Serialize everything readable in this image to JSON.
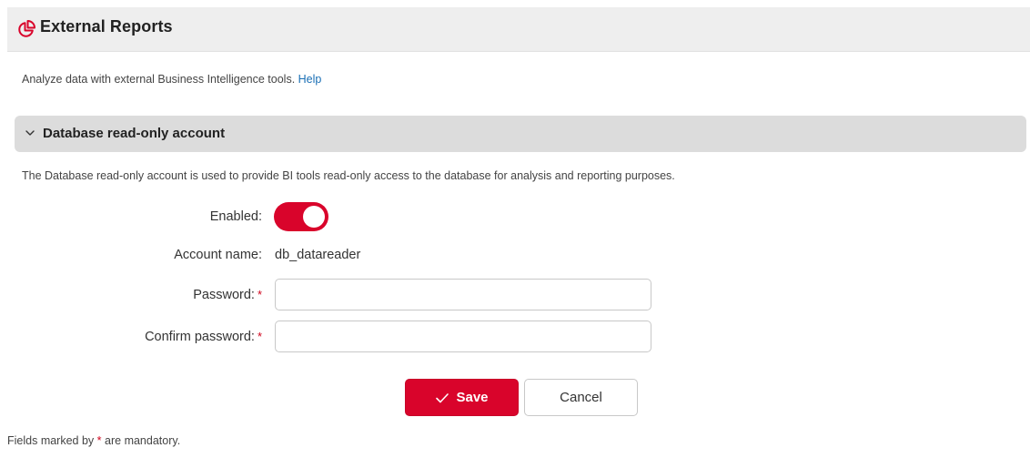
{
  "header": {
    "title": "External Reports",
    "icon": "pie-chart-icon"
  },
  "intro": {
    "text": "Analyze data with external Business Intelligence tools.",
    "help_link": "Help"
  },
  "section": {
    "title": "Database read-only account",
    "chevron_icon": "chevron-down-icon",
    "description": "The Database read-only account is used to provide BI tools read-only access to the database for analysis and reporting purposes."
  },
  "form": {
    "enabled_label": "Enabled:",
    "enabled_value": true,
    "account_name_label": "Account name:",
    "account_name_value": "db_datareader",
    "password_label": "Password:",
    "password_value": "",
    "confirm_password_label": "Confirm password:",
    "confirm_password_value": "",
    "required_marker": "*"
  },
  "actions": {
    "save_label": "Save",
    "save_icon": "check-icon",
    "cancel_label": "Cancel"
  },
  "footer": {
    "prefix": "Fields marked by",
    "marker": "*",
    "suffix": "are mandatory."
  },
  "colors": {
    "accent": "#d9042b",
    "header_bg": "#eeeeee",
    "section_bg": "#dcdcdc",
    "link": "#1a6fb5"
  }
}
